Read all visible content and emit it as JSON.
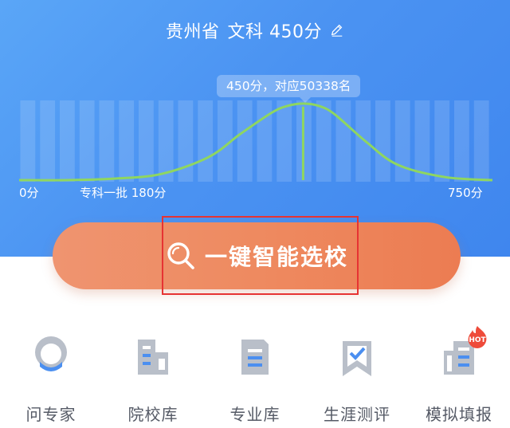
{
  "header": {
    "province": "贵州省",
    "track_score": "文科 450分"
  },
  "tooltip": {
    "text": "450分，对应50338名"
  },
  "chart_data": {
    "type": "area",
    "x_min_label": "0分",
    "x_max_label": "750分",
    "threshold_label": "专科一批 180分",
    "xlim": [
      0,
      750
    ],
    "threshold": 180,
    "marker": 450,
    "x": [
      0,
      75,
      150,
      225,
      300,
      350,
      400,
      425,
      450,
      475,
      500,
      550,
      600,
      675,
      750
    ],
    "values": [
      0,
      0.0,
      0.02,
      0.08,
      0.3,
      0.6,
      0.88,
      0.97,
      1.0,
      0.97,
      0.86,
      0.5,
      0.2,
      0.04,
      0.0
    ]
  },
  "cta": {
    "label": "一键智能选校",
    "icon": "search-icon"
  },
  "menu": {
    "items": [
      {
        "label": "问专家",
        "icon": "expert-icon"
      },
      {
        "label": "院校库",
        "icon": "buildings-icon"
      },
      {
        "label": "专业库",
        "icon": "document-icon"
      },
      {
        "label": "生涯测评",
        "icon": "bookmark-check-icon"
      },
      {
        "label": "模拟填报",
        "icon": "newspaper-icon"
      }
    ],
    "hot_badge": "HOT"
  },
  "colors": {
    "hero_blue": "#4b93f2",
    "curve_green": "#8fd660",
    "cta_orange": "#ee8a60",
    "icon_gray": "#b9bfc9",
    "icon_blue": "#4b8ff0",
    "hot_red": "#ee4b3a"
  }
}
